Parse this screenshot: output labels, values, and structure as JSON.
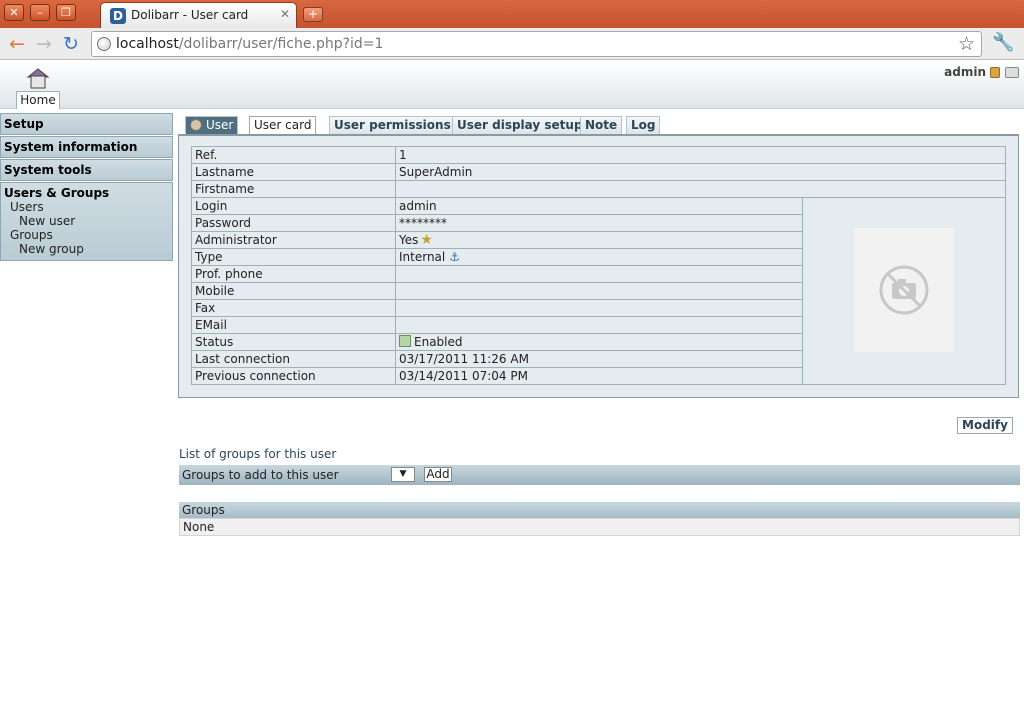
{
  "browser": {
    "tab_title": "Dolibarr - User card",
    "url_host": "localhost",
    "url_path": "/dolibarr/user/fiche.php?id=1"
  },
  "header": {
    "home_label": "Home",
    "login_name": "admin"
  },
  "menu": {
    "setup": "Setup",
    "system_information": "System information",
    "system_tools": "System tools",
    "users_groups": "Users & Groups",
    "users": "Users",
    "new_user": "New user",
    "groups": "Groups",
    "new_group": "New group"
  },
  "tabs": {
    "head": "User",
    "user_card": "User card",
    "user_permissions": "User permissions",
    "user_display_setup": "User display setup",
    "note": "Note",
    "log": "Log"
  },
  "card": {
    "ref_label": "Ref.",
    "ref_value": "1",
    "lastname_label": "Lastname",
    "lastname_value": "SuperAdmin",
    "firstname_label": "Firstname",
    "firstname_value": "",
    "login_label": "Login",
    "login_value": "admin",
    "password_label": "Password",
    "password_value": "********",
    "admin_label": "Administrator",
    "admin_value": "Yes",
    "type_label": "Type",
    "type_value": "Internal",
    "prof_phone_label": "Prof. phone",
    "mobile_label": "Mobile",
    "fax_label": "Fax",
    "email_label": "EMail",
    "status_label": "Status",
    "status_value": "Enabled",
    "last_connection_label": "Last connection",
    "last_connection_value": "03/17/2011 11:26 AM",
    "prev_connection_label": "Previous connection",
    "prev_connection_value": "03/14/2011 07:04 PM"
  },
  "actions": {
    "modify": "Modify"
  },
  "groups_section": {
    "title": "List of groups for this user",
    "add_label": "Groups to add to this user",
    "add_button": "Add",
    "table_header": "Groups",
    "empty_value": "None"
  },
  "colors": {
    "chrome_orange": "#c4532f",
    "menu_bg": "#b9cbd4",
    "tab_head": "#4f6f80",
    "status_enabled": "#b5d5a6"
  }
}
